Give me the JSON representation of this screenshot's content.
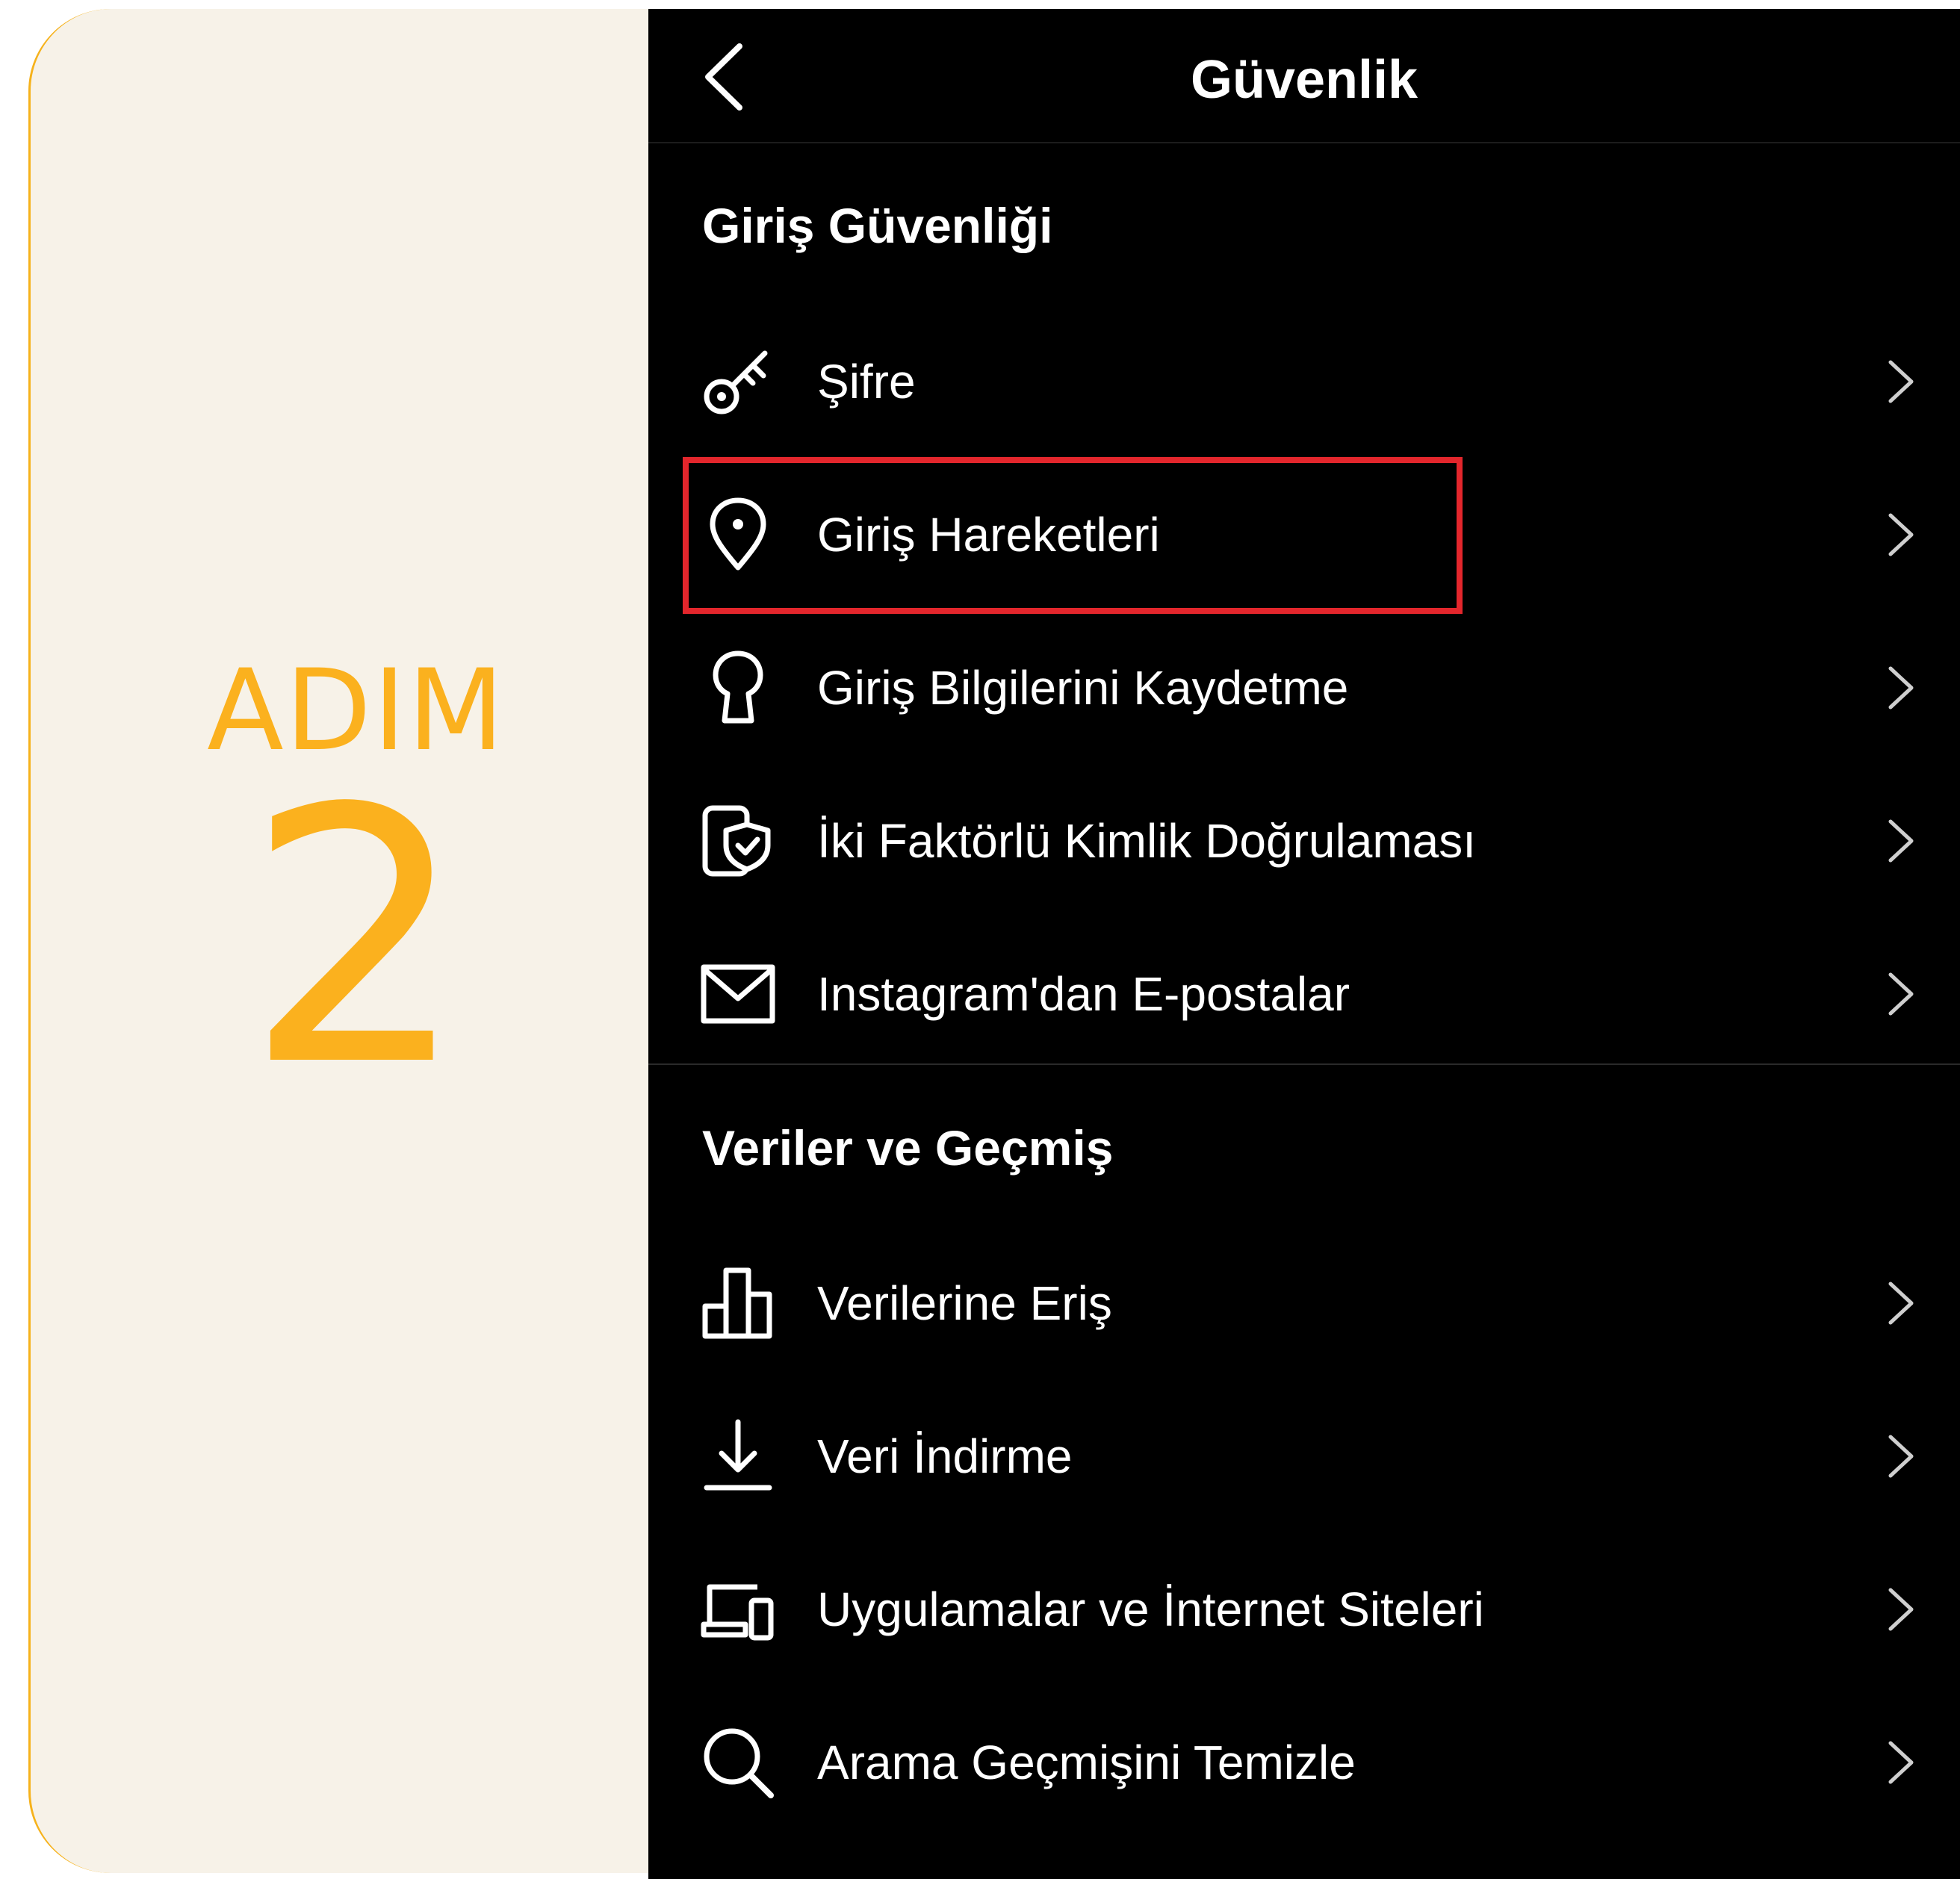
{
  "step": {
    "label": "ADIM",
    "number": "2"
  },
  "header": {
    "title": "Güvenlik",
    "back_icon": "chevron-left-icon"
  },
  "sections": {
    "login_security": {
      "title": "Giriş Güvenliği",
      "items": [
        {
          "label": "Şifre",
          "icon": "key-icon"
        },
        {
          "label": "Giriş Hareketleri",
          "icon": "location-pin-icon"
        },
        {
          "label": "Giriş Bilgilerini Kaydetme",
          "icon": "keyhole-icon"
        },
        {
          "label": "İki Faktörlü Kimlik Doğrulaması",
          "icon": "shield-phone-icon"
        },
        {
          "label": "Instagram'dan E-postalar",
          "icon": "mail-icon"
        }
      ]
    },
    "data_history": {
      "title": "Veriler ve Geçmiş",
      "items": [
        {
          "label": "Verilerine Eriş",
          "icon": "bar-chart-icon"
        },
        {
          "label": "Veri İndirme",
          "icon": "download-icon"
        },
        {
          "label": "Uygulamalar ve İnternet Siteleri",
          "icon": "devices-icon"
        },
        {
          "label": "Arama Geçmişini Temizle",
          "icon": "search-icon"
        }
      ]
    }
  },
  "colors": {
    "step_accent": "#fbb11e",
    "step_background": "#f7f2e8",
    "highlight": "#e3262c",
    "screen_background": "#000000",
    "text": "#ffffff"
  },
  "highlighted_item": "Giriş Hareketleri"
}
